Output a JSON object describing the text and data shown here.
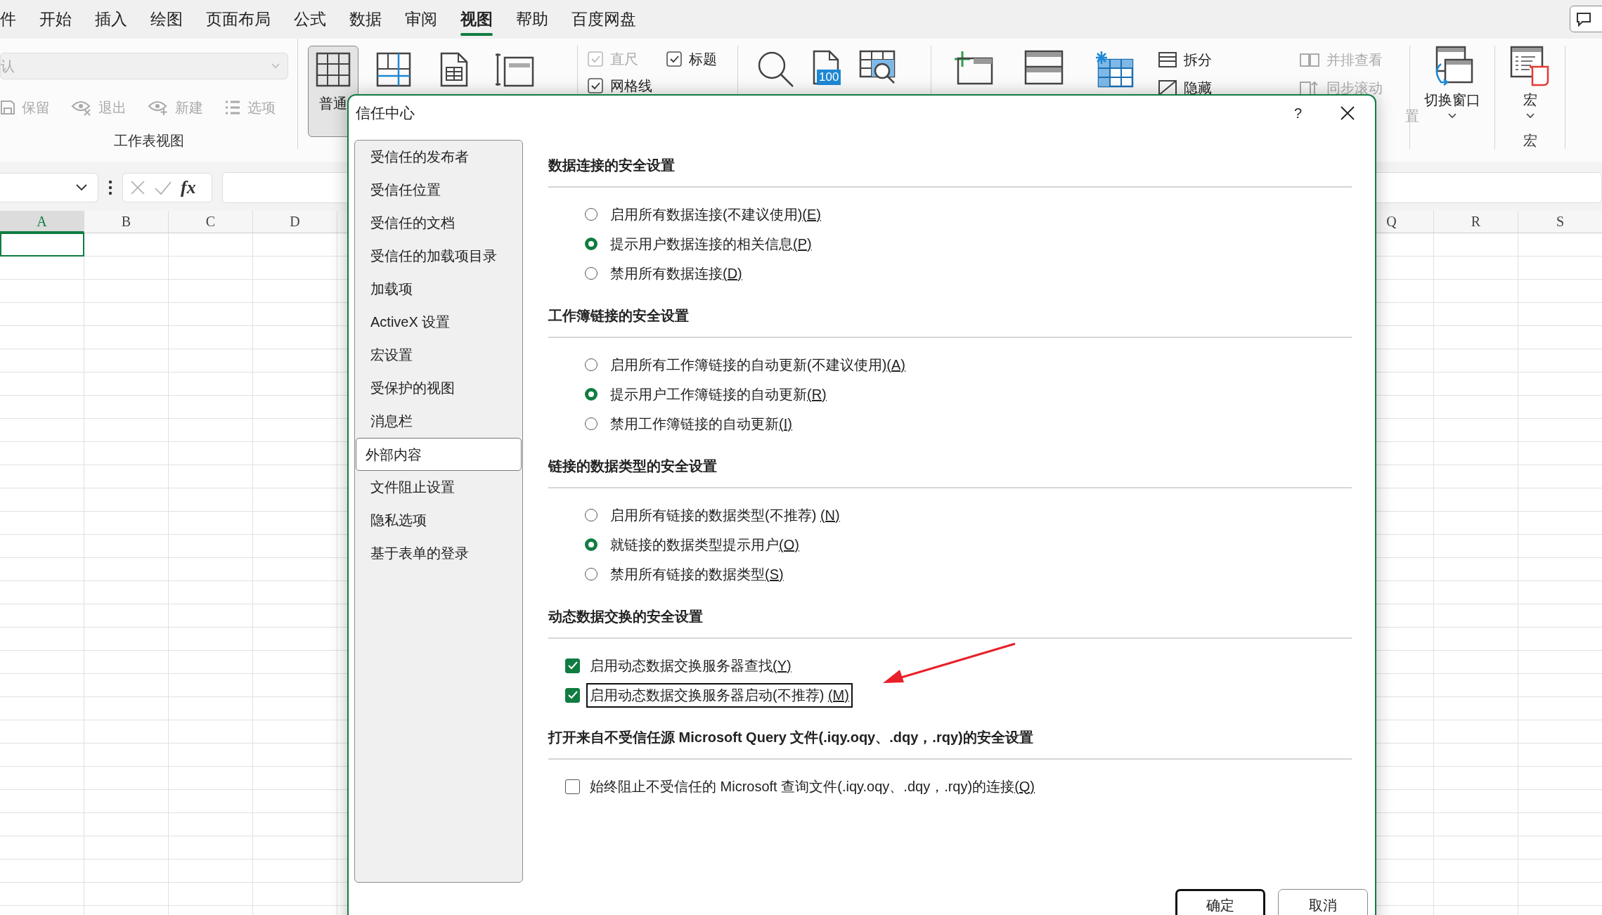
{
  "ribbon_tabs": [
    {
      "label": "件",
      "selected": false
    },
    {
      "label": "开始",
      "selected": false
    },
    {
      "label": "插入",
      "selected": false
    },
    {
      "label": "绘图",
      "selected": false
    },
    {
      "label": "页面布局",
      "selected": false
    },
    {
      "label": "公式",
      "selected": false
    },
    {
      "label": "数据",
      "selected": false
    },
    {
      "label": "审阅",
      "selected": false
    },
    {
      "label": "视图",
      "selected": true
    },
    {
      "label": "帮助",
      "selected": false
    },
    {
      "label": "百度网盘",
      "selected": false
    }
  ],
  "ribbon": {
    "sheet_view": {
      "dropdown_value": "认",
      "buttons": [
        {
          "label": "保留",
          "kind": "save"
        },
        {
          "label": "退出",
          "kind": "exit"
        },
        {
          "label": "新建",
          "kind": "new"
        },
        {
          "label": "选项",
          "kind": "options"
        }
      ],
      "group_label": "工作表视图"
    },
    "workbook_views": [
      {
        "label": "普通",
        "kind": "normal",
        "selected": true
      },
      {
        "kind": "page_break",
        "selected": false
      },
      {
        "kind": "page_layout",
        "selected": false
      },
      {
        "kind": "custom",
        "selected": false
      }
    ],
    "show": [
      {
        "label": "直尺",
        "checked": true,
        "disabled": true
      },
      {
        "label": "标题",
        "checked": true,
        "disabled": false
      },
      {
        "label": "网格线",
        "checked": true,
        "disabled": false
      }
    ],
    "zoom": [
      {
        "kind": "zoom"
      },
      {
        "kind": "zoom100",
        "badge": "100"
      },
      {
        "kind": "zoom_selection"
      }
    ],
    "window": {
      "big": [
        {
          "kind": "new_window"
        },
        {
          "kind": "arrange"
        },
        {
          "kind": "freeze"
        }
      ],
      "small": [
        {
          "label": "拆分",
          "kind": "split",
          "disabled": false
        },
        {
          "label": "隐藏",
          "kind": "hide",
          "disabled": false
        }
      ],
      "side": [
        {
          "label": "并排查看",
          "kind": "side_by_side",
          "disabled": true
        },
        {
          "label": "同步滚动",
          "kind": "sync",
          "disabled": true
        },
        {
          "label": "置",
          "kind": "reset",
          "disabled": true
        }
      ],
      "switch_label": "切换窗口"
    },
    "macros": {
      "label": "宏",
      "group_label": "宏"
    }
  },
  "formula_bar": {
    "function_label": "fx"
  },
  "sheet": {
    "columns_left": [
      {
        "label": "A",
        "selected": true
      },
      {
        "label": "B",
        "selected": false
      },
      {
        "label": "C",
        "selected": false
      },
      {
        "label": "D",
        "selected": false
      }
    ],
    "columns_right": [
      {
        "label": "Q",
        "selected": false
      },
      {
        "label": "R",
        "selected": false
      },
      {
        "label": "S",
        "selected": false
      }
    ]
  },
  "dialog": {
    "title": "信任中心",
    "help": "?",
    "nav": [
      {
        "label": "受信任的发布者",
        "selected": false
      },
      {
        "label": "受信任位置",
        "selected": false
      },
      {
        "label": "受信任的文档",
        "selected": false
      },
      {
        "label": "受信任的加载项目录",
        "selected": false
      },
      {
        "label": "加载项",
        "selected": false
      },
      {
        "label": "ActiveX 设置",
        "selected": false
      },
      {
        "label": "宏设置",
        "selected": false
      },
      {
        "label": "受保护的视图",
        "selected": false
      },
      {
        "label": "消息栏",
        "selected": false
      },
      {
        "label": "外部内容",
        "selected": true
      },
      {
        "label": "文件阻止设置",
        "selected": false
      },
      {
        "label": "隐私选项",
        "selected": false
      },
      {
        "label": "基于表单的登录",
        "selected": false
      }
    ],
    "sections": [
      {
        "heading": "数据连接的安全设置",
        "kind": "radio",
        "options": [
          {
            "label": "启用所有数据连接(不建议使用)",
            "key": "(E)",
            "selected": false
          },
          {
            "label": "提示用户数据连接的相关信息",
            "key": "(P)",
            "selected": true
          },
          {
            "label": "禁用所有数据连接",
            "key": "(D)",
            "selected": false
          }
        ]
      },
      {
        "heading": "工作簿链接的安全设置",
        "kind": "radio",
        "options": [
          {
            "label": "启用所有工作簿链接的自动更新(不建议使用)",
            "key": "(A)",
            "selected": false
          },
          {
            "label": "提示用户工作簿链接的自动更新",
            "key": "(R)",
            "selected": true
          },
          {
            "label": "禁用工作簿链接的自动更新",
            "key": "(I)",
            "selected": false
          }
        ]
      },
      {
        "heading": "链接的数据类型的安全设置",
        "kind": "radio",
        "options": [
          {
            "label": "启用所有链接的数据类型(不推荐) ",
            "key": "(N)",
            "selected": false
          },
          {
            "label": "就链接的数据类型提示用户",
            "key": "(O)",
            "selected": true
          },
          {
            "label": "禁用所有链接的数据类型",
            "key": "(S)",
            "selected": false
          }
        ]
      },
      {
        "heading": "动态数据交换的安全设置",
        "kind": "checkbox",
        "options": [
          {
            "label": "启用动态数据交换服务器查找",
            "key": "(Y)",
            "checked": true,
            "focused": false
          },
          {
            "label": "启用动态数据交换服务器启动(不推荐) ",
            "key": "(M)",
            "checked": true,
            "focused": true
          }
        ]
      },
      {
        "heading": "打开来自不受信任源 Microsoft Query 文件(.iqy.oqy、.dqy，.rqy)的安全设置",
        "kind": "checkbox",
        "options": [
          {
            "label": "始终阻止不受信任的 Microsoft 查询文件(.iqy.oqy、.dqy，.rqy)的连接",
            "key": "(Q)",
            "checked": false,
            "focused": false
          }
        ]
      }
    ],
    "buttons": [
      {
        "label": "确定",
        "default": true
      },
      {
        "label": "取消",
        "default": false
      }
    ]
  }
}
